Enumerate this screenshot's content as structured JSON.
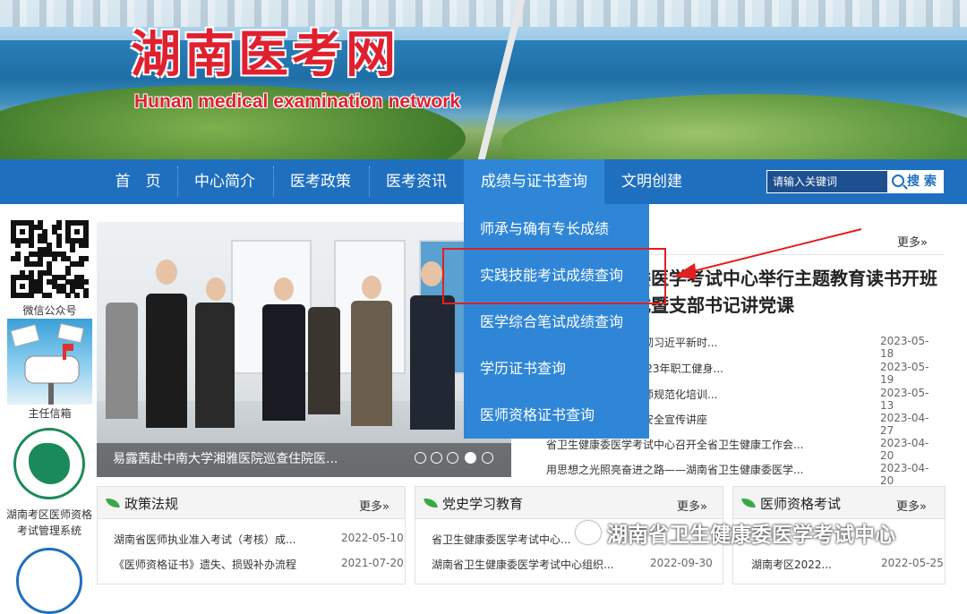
{
  "banner": {
    "title": "湖南医考网",
    "subtitle": "Hunan medical examination network"
  },
  "nav": {
    "items": [
      "首　页",
      "中心简介",
      "医考政策",
      "医考资讯",
      "成绩与证书查询",
      "文明创建"
    ],
    "active_index": 4,
    "search_placeholder": "请输入关键词",
    "search_button": "搜 索"
  },
  "dropdown": {
    "items": [
      "师承与确有专长成绩",
      "实践技能考试成绩查询",
      "医学综合笔试成绩查询",
      "学历证书查询",
      "医师资格证书查询"
    ],
    "highlighted_index": 1
  },
  "sidebar": {
    "qr_caption": "微信公众号",
    "mail_caption": "主任信箱",
    "system_caption": "湖南考区医师资格考试管理系统"
  },
  "slider": {
    "caption": "易露茜赴中南大学湘雅医院巡查住院医...",
    "dots": 5,
    "active_dot": 3
  },
  "news": {
    "more": "更多»",
    "headline": "委医学考试中心举行主题教育读书开班式暨支部书记讲党课",
    "items": [
      {
        "title": "考试中心召开学习贯彻习近平新时...",
        "date": "2023-05-18"
      },
      {
        "title": "考试中心积极参加2023年职工健身...",
        "date": "2023-05-19"
      },
      {
        "title": "湘雅医院巡查住院医师规范化培训...",
        "date": "2023-05-13"
      },
      {
        "title": "学考试中心组织开展安全宣传讲座",
        "date": "2023-04-27"
      },
      {
        "title": "省卫生健康委医学考试中心召开全省卫生健康工作会...",
        "date": "2023-04-20"
      },
      {
        "title": "用思想之光照亮奋进之路——湖南省卫生健康委医学...",
        "date": "2023-04-20"
      }
    ]
  },
  "panels": [
    {
      "title": "政策法规",
      "more": "更多»",
      "rows": [
        {
          "title": "湖南省医师执业准入考试（考核）成...",
          "date": "2022-05-10"
        },
        {
          "title": "《医师资格证书》遗失、损毁补办流程",
          "date": "2021-07-20"
        }
      ]
    },
    {
      "title": "党史学习教育",
      "more": "更多»",
      "rows": [
        {
          "title": "省卫生健康委医学考试中心...",
          "date": ""
        },
        {
          "title": "湖南省卫生健康委医学考试中心组织...",
          "date": "2022-09-30"
        }
      ]
    },
    {
      "title": "医师资格考试",
      "more": "更多»",
      "rows": [
        {
          "title": "",
          "date": ""
        },
        {
          "title": "湖南考区2022...",
          "date": "2022-05-25"
        }
      ]
    }
  ],
  "watermark": "湖南省卫生健康委医学考试中心",
  "colors": {
    "nav": "#1f6fbf",
    "dropdown": "#2f86d6",
    "highlight": "#e02020",
    "title": "#e0202e"
  }
}
